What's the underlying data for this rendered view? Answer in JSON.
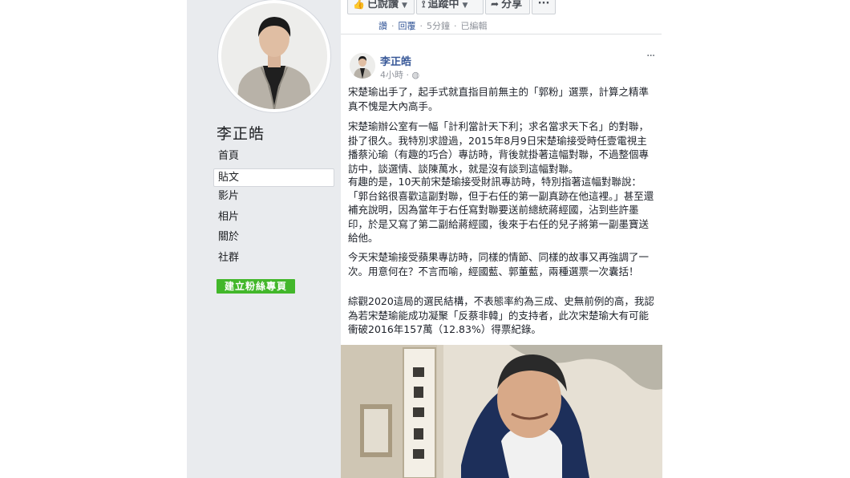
{
  "profile": {
    "name": "李正皓",
    "nav": [
      "首頁",
      "貼文",
      "影片",
      "相片",
      "關於",
      "社群"
    ],
    "selected_nav": "貼文",
    "create_page_button": "建立粉絲專頁"
  },
  "top_actions": {
    "liked_label": "已說讚",
    "following_label": "追蹤中",
    "share_label": "分享",
    "more_label": "···"
  },
  "prev_post_meta": {
    "like": "讚",
    "reply": "回覆",
    "time": "5分鐘",
    "edited": "已編輯"
  },
  "post": {
    "author": "李正皓",
    "time": "4小時",
    "privacy_icon": "globe-icon",
    "more": "···",
    "paragraphs": [
      "宋楚瑜出手了，起手式就直指目前無主的「郭粉」選票，計算之精準真不愧是大內高手。",
      "宋楚瑜辦公室有一幅「計利當計天下利；求名當求天下名」的對聯，掛了很久。我特別求證過，2015年8月9日宋楚瑜接受時任壹電視主播蔡沁瑜（有趣的巧合）專訪時，背後就掛著這幅對聯，不過整個專訪中，談選情、談陳萬水，就是沒有談到這幅對聯。",
      "有趣的是，10天前宋楚瑜接受財訊專訪時，特別指著這幅對聯說：「郭台銘很喜歡這副對聯，但于右任的第一副真跡在他這裡。」甚至還補充說明，因為當年于右任寫對聯要送前總統蔣經國，沾到些許墨印，於是又寫了第二副給蔣經國，後來于右任的兒子將第一副墨寶送給他。",
      "今天宋楚瑜接受蘋果專訪時，同樣的情節、同樣的故事又再強調了一次。用意何在？不言而喻，經國藍、郭董藍，兩種選票一次囊括！",
      "綜觀2020這局的選民結構，不表態率約為三成、史無前例的高，我認為若宋楚瑜能成功凝聚「反蔡非韓」的支持者，此次宋楚瑜大有可能衝破2016年157萬（12.83%）得票紀錄。"
    ]
  },
  "colors": {
    "link": "#385898",
    "green_button": "#42b72a",
    "sidebar_bg": "#e9ebee"
  }
}
